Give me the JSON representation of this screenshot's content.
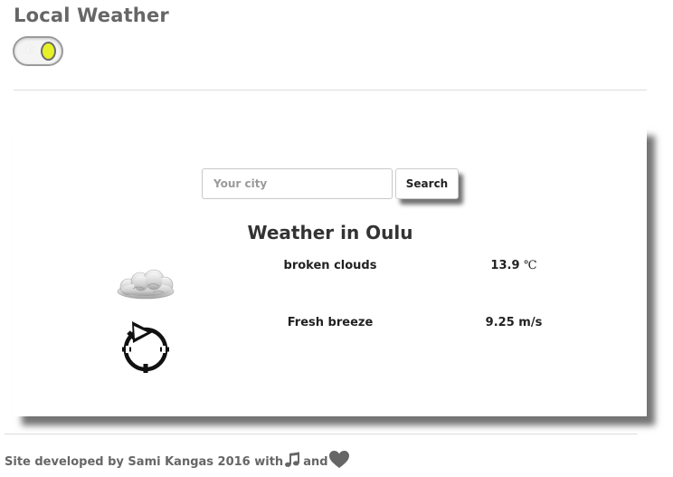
{
  "header": {
    "title": "Local Weather",
    "unit_toggle": {
      "letter": "C",
      "state": "on",
      "knob_color": "#e6f227"
    }
  },
  "search": {
    "placeholder": "Your city",
    "value": "",
    "button_label": "Search"
  },
  "weather": {
    "heading": "Weather in Oulu",
    "condition": {
      "icon": "cloud-icon",
      "description": "broken clouds",
      "temperature": "13.9",
      "temperature_unit": "℃"
    },
    "wind": {
      "icon": "wind-direction-icon",
      "description": "Fresh breeze",
      "speed": "9.25 m/s"
    }
  },
  "footer": {
    "text_before": "Site developed by Sami Kangas 2016 with",
    "music_icon": "music-note-icon",
    "text_and": "and",
    "heart_icon": "heart-icon"
  }
}
